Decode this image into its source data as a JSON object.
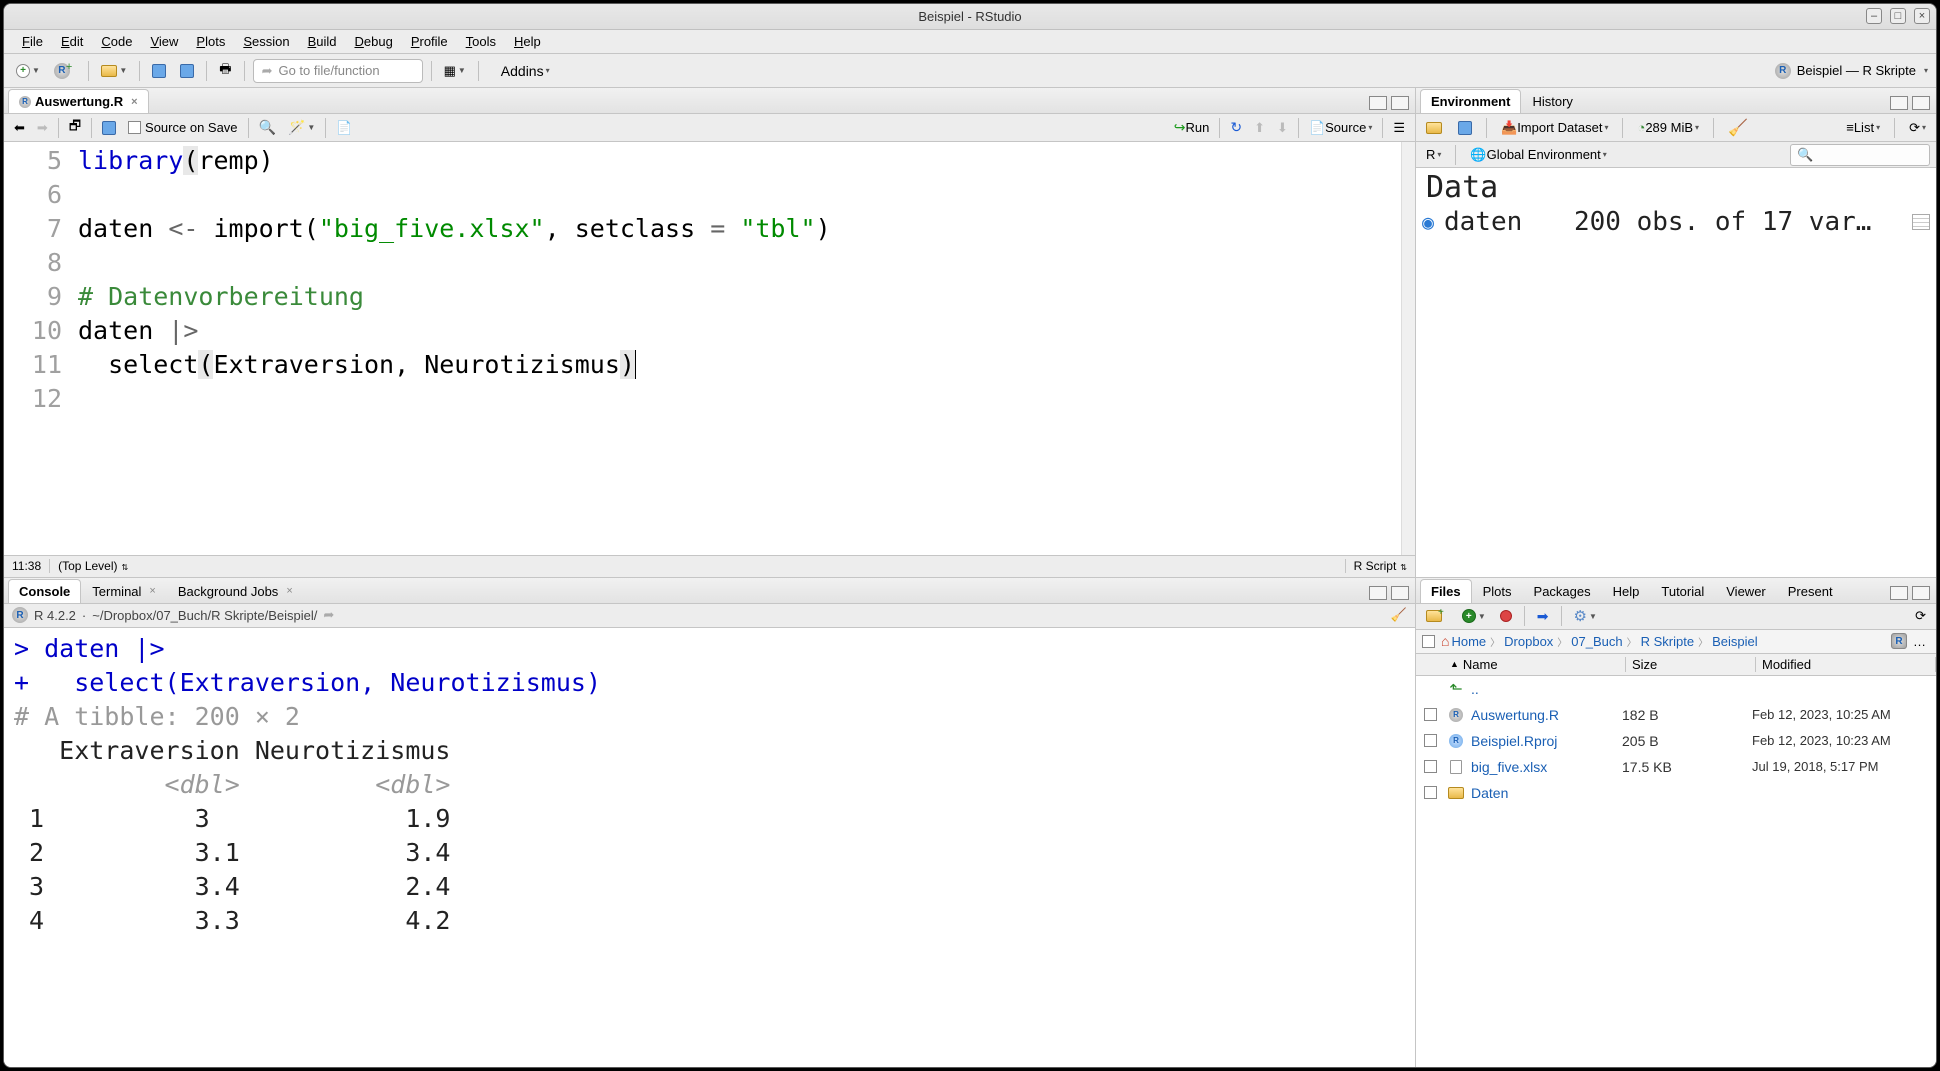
{
  "window": {
    "title": "Beispiel - RStudio"
  },
  "menus": [
    "File",
    "Edit",
    "Code",
    "View",
    "Plots",
    "Session",
    "Build",
    "Debug",
    "Profile",
    "Tools",
    "Help"
  ],
  "toolbar": {
    "goto_placeholder": "Go to file/function",
    "addins": "Addins",
    "project": "Beispiel — R Skripte"
  },
  "source": {
    "tab": "Auswertung.R",
    "sourceOnSave": "Source on Save",
    "run": "Run",
    "sourceBtn": "Source",
    "lines": [
      {
        "n": 5,
        "tokens": [
          {
            "t": "library",
            "c": "kw"
          },
          {
            "t": "(",
            "c": "pbr"
          },
          {
            "t": "remp",
            "c": "fn"
          },
          {
            "t": ")",
            "c": ""
          }
        ]
      },
      {
        "n": 6,
        "tokens": []
      },
      {
        "n": 7,
        "tokens": [
          {
            "t": "daten ",
            "c": "fn"
          },
          {
            "t": "<- ",
            "c": "op"
          },
          {
            "t": "import",
            "c": "fn"
          },
          {
            "t": "(",
            "c": ""
          },
          {
            "t": "\"big_five.xlsx\"",
            "c": "str"
          },
          {
            "t": ", setclass ",
            "c": "fn"
          },
          {
            "t": "= ",
            "c": "op"
          },
          {
            "t": "\"tbl\"",
            "c": "str"
          },
          {
            "t": ")",
            "c": ""
          }
        ]
      },
      {
        "n": 8,
        "tokens": []
      },
      {
        "n": 9,
        "tokens": [
          {
            "t": "# Datenvorbereitung",
            "c": "cm"
          }
        ]
      },
      {
        "n": 10,
        "tokens": [
          {
            "t": "daten ",
            "c": "fn"
          },
          {
            "t": "|>",
            "c": "op"
          }
        ]
      },
      {
        "n": 11,
        "tokens": [
          {
            "t": "  select",
            "c": "fn"
          },
          {
            "t": "(",
            "c": "pbr"
          },
          {
            "t": "Extraversion, Neurotizismus",
            "c": "fn"
          },
          {
            "t": ")",
            "c": "pbr"
          },
          {
            "t": "|",
            "c": "cursor"
          }
        ]
      },
      {
        "n": 12,
        "tokens": []
      }
    ],
    "status_pos": "11:38",
    "status_scope": "(Top Level)",
    "status_type": "R Script"
  },
  "console": {
    "tabs": [
      "Console",
      "Terminal",
      "Background Jobs"
    ],
    "version": "R 4.2.2",
    "path": "~/Dropbox/07_Buch/R Skripte/Beispiel/",
    "lines": [
      {
        "pre": "> ",
        "txt": "daten |>",
        "cls": "pr"
      },
      {
        "pre": "+   ",
        "txt": "select(Extraversion, Neurotizismus)",
        "cls": "pr"
      },
      {
        "txt": "# A tibble: 200 × 2",
        "cls": "hdr"
      },
      {
        "txt": "   Extraversion Neurotizismus",
        "cls": "blk"
      },
      {
        "txt": "          <dbl>         <dbl>",
        "cls": "it"
      },
      {
        "txt": " 1          3             1.9",
        "cls": "blk"
      },
      {
        "txt": " 2          3.1           3.4",
        "cls": "blk"
      },
      {
        "txt": " 3          3.4           2.4",
        "cls": "blk"
      },
      {
        "txt": " 4          3.3           4.2",
        "cls": "blk"
      }
    ]
  },
  "env": {
    "tabs": [
      "Environment",
      "History"
    ],
    "import": "Import Dataset",
    "mem": "289 MiB",
    "list": "List",
    "rmenu": "R",
    "globenv": "Global Environment",
    "cat": "Data",
    "row_name": "daten",
    "row_val": "200 obs. of 17 var…"
  },
  "files": {
    "tabs": [
      "Files",
      "Plots",
      "Packages",
      "Help",
      "Tutorial",
      "Viewer",
      "Present"
    ],
    "crumbs": [
      "Home",
      "Dropbox",
      "07_Buch",
      "R Skripte",
      "Beispiel"
    ],
    "head_name": "Name",
    "head_size": "Size",
    "head_mod": "Modified",
    "up": "..",
    "rows": [
      {
        "icon": "r",
        "name": "Auswertung.R",
        "size": "182 B",
        "mod": "Feb 12, 2023, 10:25 AM"
      },
      {
        "icon": "rp",
        "name": "Beispiel.Rproj",
        "size": "205 B",
        "mod": "Feb 12, 2023, 10:23 AM"
      },
      {
        "icon": "doc",
        "name": "big_five.xlsx",
        "size": "17.5 KB",
        "mod": "Jul 19, 2018, 5:17 PM"
      },
      {
        "icon": "folder",
        "name": "Daten",
        "size": "",
        "mod": ""
      }
    ]
  }
}
